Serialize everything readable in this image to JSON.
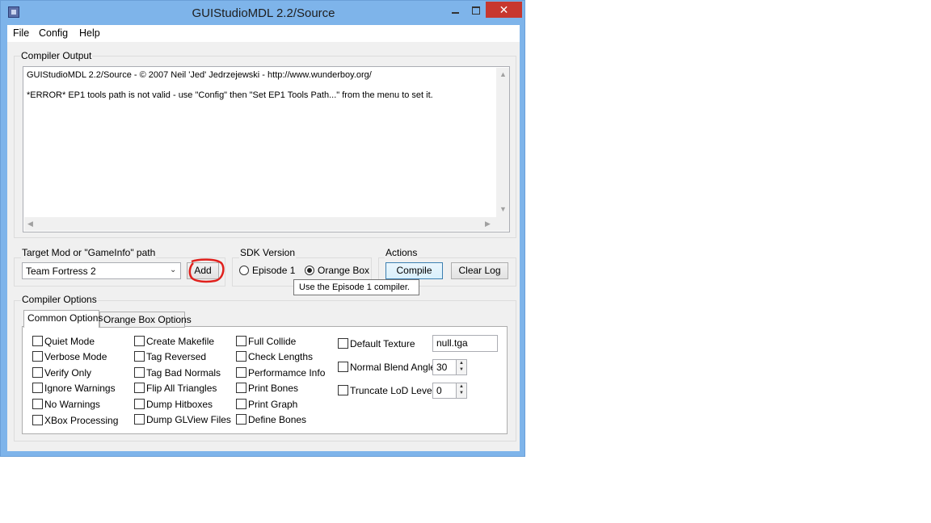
{
  "window": {
    "title": "GUIStudioMDL 2.2/Source",
    "close_glyph": "✕"
  },
  "menu": [
    "File",
    "Config",
    "Help"
  ],
  "compiler_output": {
    "label": "Compiler Output",
    "lines": [
      "GUIStudioMDL 2.2/Source - © 2007 Neil 'Jed' Jedrzejewski - http://www.wunderboy.org/",
      "*ERROR* EP1 tools path is not valid - use \"Config\" then \"Set EP1 Tools Path...\" from the menu to set it."
    ]
  },
  "target": {
    "label": "Target Mod or \"GameInfo\" path",
    "value": "Team Fortress 2",
    "add_label": "Add",
    "annotation_color": "#e0201c"
  },
  "sdk": {
    "label": "SDK Version",
    "options": [
      "Episode 1",
      "Orange Box"
    ],
    "selected": "Orange Box"
  },
  "actions": {
    "label": "Actions",
    "compile_label": "Compile",
    "clear_log_label": "Clear Log"
  },
  "tooltip": "Use the Episode 1 compiler.",
  "compiler_options": {
    "label": "Compiler Options",
    "tabs": [
      "Common Options",
      "Orange Box Options"
    ],
    "active_tab": "Common Options",
    "columns": [
      [
        "Quiet Mode",
        "Verbose Mode",
        "Verify Only",
        "Ignore Warnings",
        "No Warnings",
        "XBox Processing"
      ],
      [
        "Create Makefile",
        "Tag Reversed",
        "Tag Bad Normals",
        "Flip All Triangles",
        "Dump Hitboxes",
        "Dump GLView Files"
      ],
      [
        "Full Collide",
        "Check Lengths",
        "Performamce Info",
        "Print Bones",
        "Print Graph",
        "Define Bones"
      ]
    ],
    "default_texture": {
      "label": "Default Texture",
      "value": "null.tga"
    },
    "normal_blend_angle": {
      "label": "Normal Blend Angle",
      "value": "30"
    },
    "truncate_lod_level": {
      "label": "Truncate LoD Level",
      "value": "0"
    }
  }
}
